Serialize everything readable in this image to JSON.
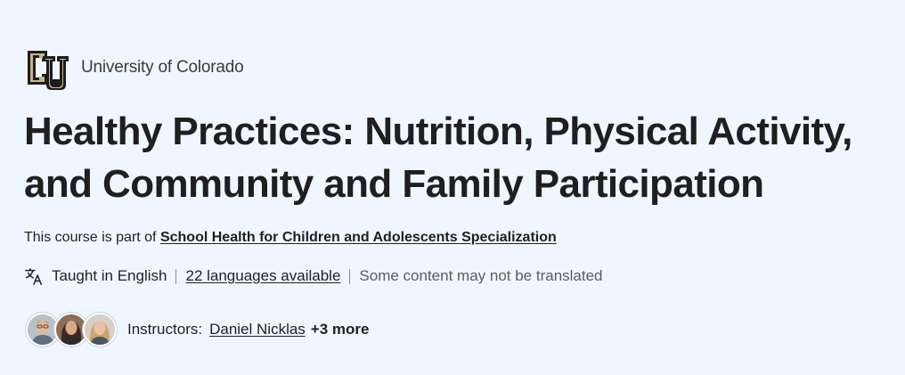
{
  "partner": {
    "name": "University of Colorado",
    "logo_icon": "cu-logo-icon",
    "logo_colors": {
      "outer": "#1d1d1d",
      "inner": "#c8b58c"
    }
  },
  "course": {
    "title": "Healthy Practices: Nutrition, Physical Activity, and Community and Family Participation"
  },
  "part_of": {
    "prefix": "This course is part of",
    "specialization": "School Health for Children and Adolescents Specialization"
  },
  "language": {
    "icon": "translate-icon",
    "taught_in": "Taught in English",
    "available": "22 languages available",
    "note": "Some content may not be translated"
  },
  "instructors": {
    "label": "Instructors:",
    "primary": "Daniel Nicklas",
    "more": "+3 more",
    "avatar_count": 3
  },
  "colors": {
    "background": "#f0f6ff",
    "text": "#1f1f1f",
    "muted": "#5b5b5b"
  }
}
